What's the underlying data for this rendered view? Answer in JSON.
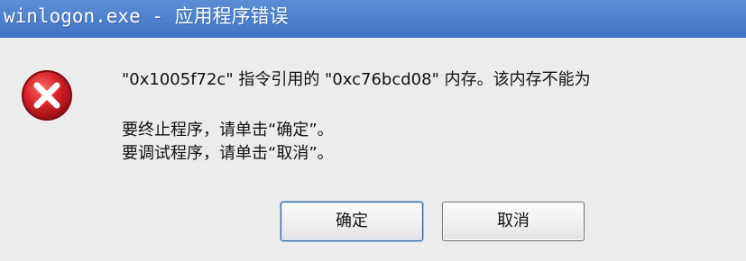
{
  "window": {
    "title": "winlogon.exe - 应用程序错误"
  },
  "icon": {
    "name": "error-icon"
  },
  "message": {
    "line1": "\"0x1005f72c\" 指令引用的 \"0xc76bcd08\" 内存。该内存不能为",
    "line2": "要终止程序，请单击“确定”。",
    "line3": "要调试程序，请单击“取消”。"
  },
  "buttons": {
    "ok_label": "确定",
    "cancel_label": "取消"
  },
  "colors": {
    "titlebar": "#4f83cf",
    "background": "#ececec",
    "icon_red": "#d2232a"
  }
}
